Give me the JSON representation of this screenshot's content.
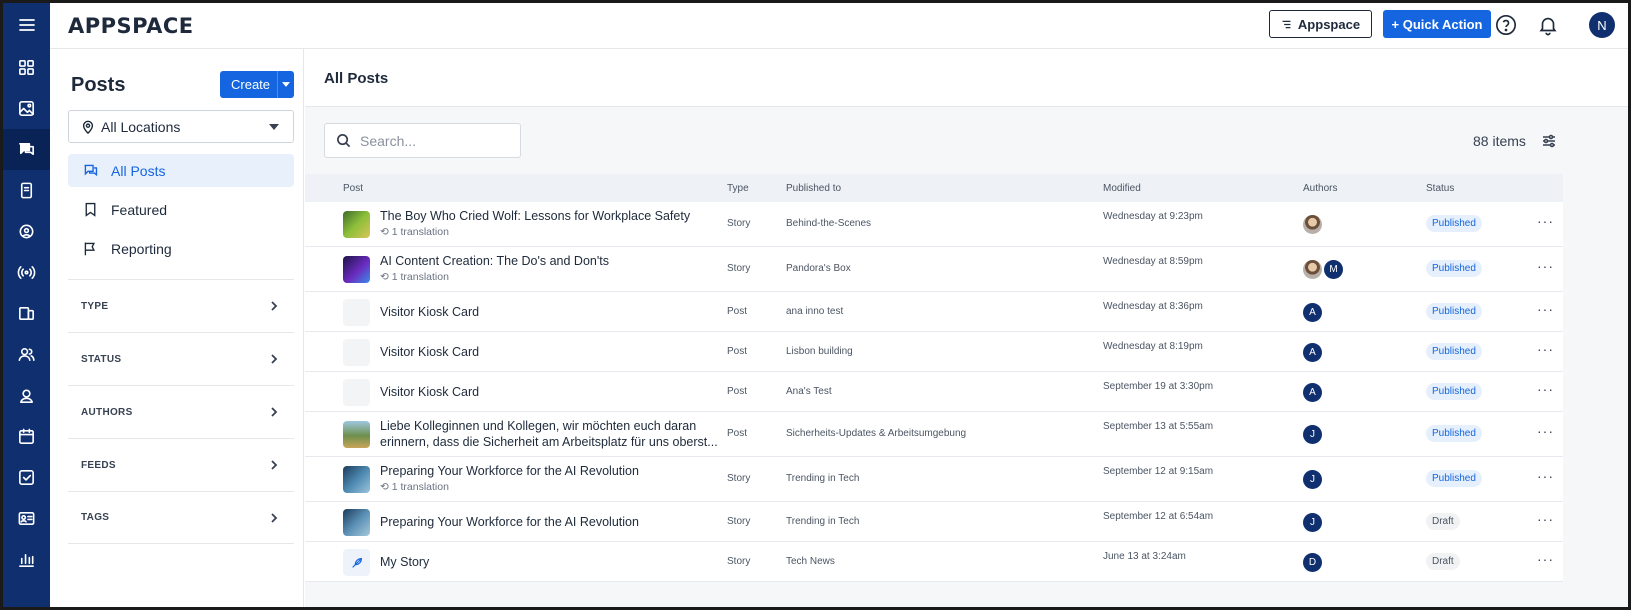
{
  "app": {
    "logo": "APPSPACE"
  },
  "topbar": {
    "appspace_button": "Appspace",
    "quick_action_button": "+ Quick Action",
    "user_initial": "N"
  },
  "rail": {
    "icons": [
      "menu-icon",
      "dashboard-icon",
      "image-icon",
      "chat-icon",
      "device-icon",
      "support-icon",
      "broadcast-icon",
      "screens-icon",
      "users-icon",
      "location-icon",
      "calendar-icon",
      "tasks-icon",
      "id-card-icon",
      "analytics-icon"
    ]
  },
  "sidebar": {
    "title": "Posts",
    "create_label": "Create",
    "location_select": "All Locations",
    "nav": [
      {
        "label": "All Posts",
        "active": true
      },
      {
        "label": "Featured"
      },
      {
        "label": "Reporting"
      }
    ],
    "filters": [
      "TYPE",
      "STATUS",
      "AUTHORS",
      "FEEDS",
      "TAGS"
    ]
  },
  "main": {
    "title": "All Posts",
    "search_placeholder": "Search...",
    "count": "88 items",
    "columns": [
      "Post",
      "Type",
      "Published to",
      "Modified",
      "Authors",
      "Status"
    ],
    "rows": [
      {
        "title": "The Boy Who Cried Wolf: Lessons for Workplace Safety",
        "translation": "1 translation",
        "type": "Story",
        "published_to": "Behind-the-Scenes",
        "modified": "Wednesday at 9:23pm",
        "authors": [
          "photo"
        ],
        "status": "Published"
      },
      {
        "title": "AI Content Creation: The Do's and Don'ts",
        "translation": "1 translation",
        "type": "Story",
        "published_to": "Pandora's Box",
        "modified": "Wednesday at 8:59pm",
        "authors": [
          "photo",
          "M"
        ],
        "status": "Published"
      },
      {
        "title": "Visitor Kiosk Card",
        "type": "Post",
        "published_to": "ana inno test",
        "modified": "Wednesday at 8:36pm",
        "authors": [
          "A"
        ],
        "status": "Published"
      },
      {
        "title": "Visitor Kiosk Card",
        "type": "Post",
        "published_to": "Lisbon building",
        "modified": "Wednesday at 8:19pm",
        "authors": [
          "A"
        ],
        "status": "Published"
      },
      {
        "title": "Visitor Kiosk Card",
        "type": "Post",
        "published_to": "Ana's Test",
        "modified": "September 19 at 3:30pm",
        "authors": [
          "A"
        ],
        "status": "Published"
      },
      {
        "title": "Liebe Kolleginnen und Kollegen, wir möchten euch daran erinnern, dass die Sicherheit am Arbeitsplatz für uns oberst...",
        "type": "Post",
        "published_to": "Sicherheits-Updates & Arbeitsumgebung",
        "modified": "September 13 at 5:55am",
        "authors": [
          "J"
        ],
        "status": "Published"
      },
      {
        "title": "Preparing Your Workforce for the AI Revolution",
        "translation": "1 translation",
        "type": "Story",
        "published_to": "Trending in Tech",
        "modified": "September 12 at 9:15am",
        "authors": [
          "J"
        ],
        "status": "Published"
      },
      {
        "title": "Preparing Your Workforce for the AI Revolution",
        "type": "Story",
        "published_to": "Trending in Tech",
        "modified": "September 12 at 6:54am",
        "authors": [
          "J"
        ],
        "status": "Draft"
      },
      {
        "title": "My Story",
        "type": "Story",
        "published_to": "Tech News",
        "modified": "June 13 at 3:24am",
        "authors": [
          "D"
        ],
        "status": "Draft"
      }
    ]
  }
}
